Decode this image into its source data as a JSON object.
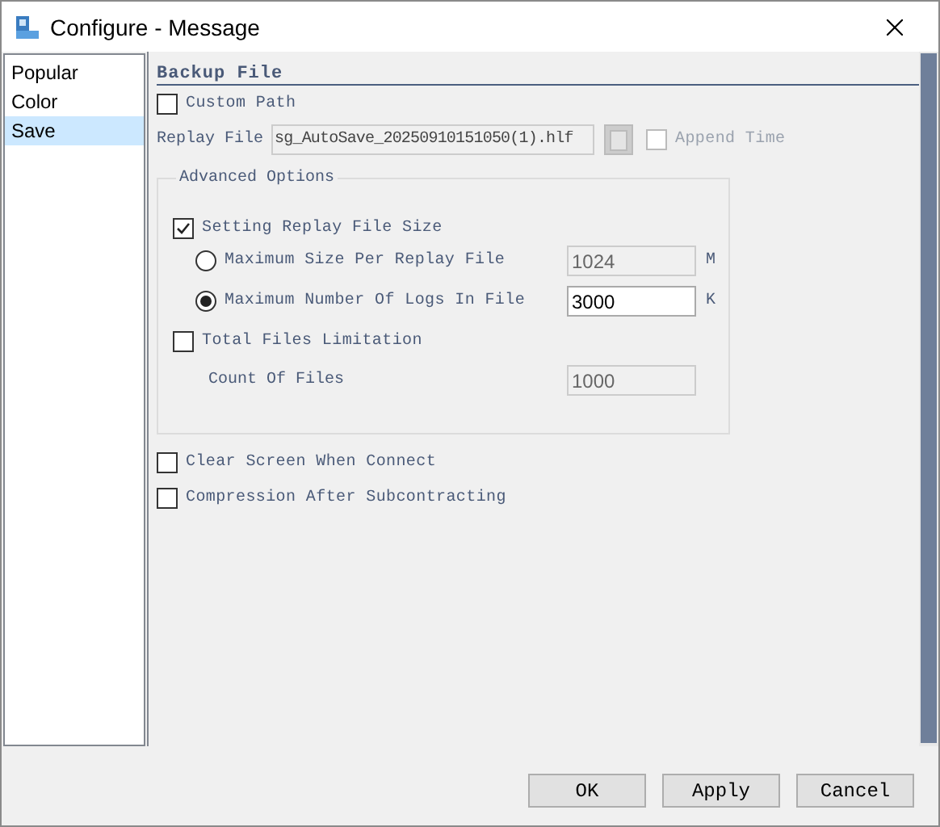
{
  "window": {
    "title": "Configure - Message"
  },
  "sidebar": {
    "items": [
      {
        "label": "Popular",
        "selected": false
      },
      {
        "label": "Color",
        "selected": false
      },
      {
        "label": "Save",
        "selected": true
      }
    ]
  },
  "backup_file": {
    "heading": "Backup File",
    "custom_path": {
      "label": "Custom Path",
      "checked": false
    },
    "replay_file": {
      "label": "Replay File",
      "value": "sg_AutoSave_20250910151050(1).hlf",
      "disabled": true
    },
    "append_time": {
      "label": "Append Time",
      "checked": false,
      "disabled": true
    }
  },
  "advanced_options": {
    "title": "Advanced Options",
    "setting_size": {
      "label": "Setting Replay File Size",
      "checked": true
    },
    "size_options": [
      {
        "label": "Maximum Size Per Replay File",
        "selected": false,
        "value": "1024",
        "disabled": true,
        "unit": "M"
      },
      {
        "label": "Maximum Number Of Logs In File",
        "selected": true,
        "value": "3000",
        "disabled": false,
        "unit": "K"
      }
    ],
    "total_files": {
      "label": "Total Files Limitation",
      "checked": false
    },
    "count_of_files": {
      "label": "Count Of Files",
      "value": "1000",
      "disabled": true
    }
  },
  "options": [
    {
      "label": "Clear Screen When Connect",
      "checked": false
    },
    {
      "label": "Compression After Subcontracting",
      "checked": false
    }
  ],
  "buttons": [
    "OK",
    "Apply",
    "Cancel"
  ]
}
